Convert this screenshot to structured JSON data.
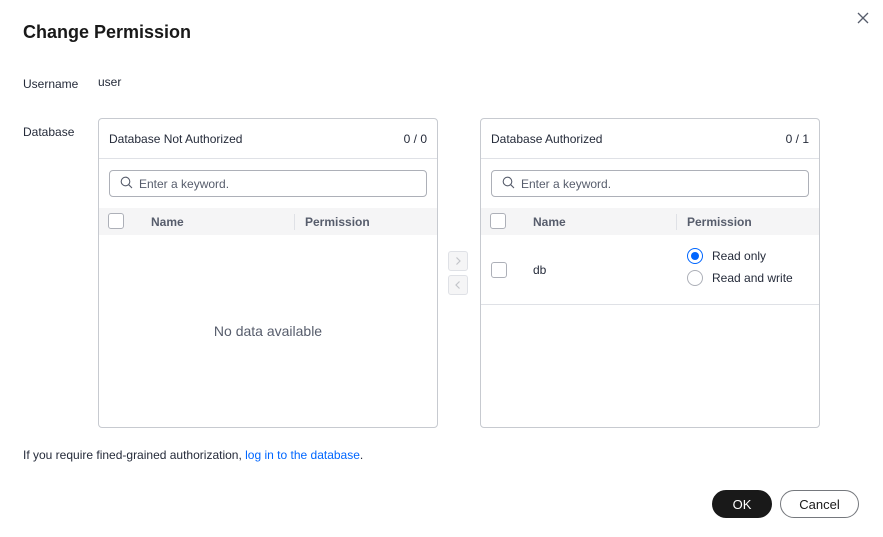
{
  "dialog": {
    "title": "Change Permission",
    "username_label": "Username",
    "username_value": "user",
    "database_label": "Database"
  },
  "left_panel": {
    "title": "Database Not Authorized",
    "count": "0 / 0",
    "search_placeholder": "Enter a keyword.",
    "col_name": "Name",
    "col_permission": "Permission",
    "empty_text": "No data available"
  },
  "right_panel": {
    "title": "Database Authorized",
    "count": "0 / 1",
    "search_placeholder": "Enter a keyword.",
    "col_name": "Name",
    "col_permission": "Permission",
    "rows": [
      {
        "name": "db",
        "options": [
          "Read only",
          "Read and write"
        ],
        "selected": "Read only"
      }
    ]
  },
  "footer": {
    "note_prefix": "If you require fined-grained authorization, ",
    "note_link": "log in to the database",
    "note_suffix": ".",
    "ok_label": "OK",
    "cancel_label": "Cancel"
  },
  "colors": {
    "accent": "#0066ff",
    "primary_button": "#191919"
  }
}
